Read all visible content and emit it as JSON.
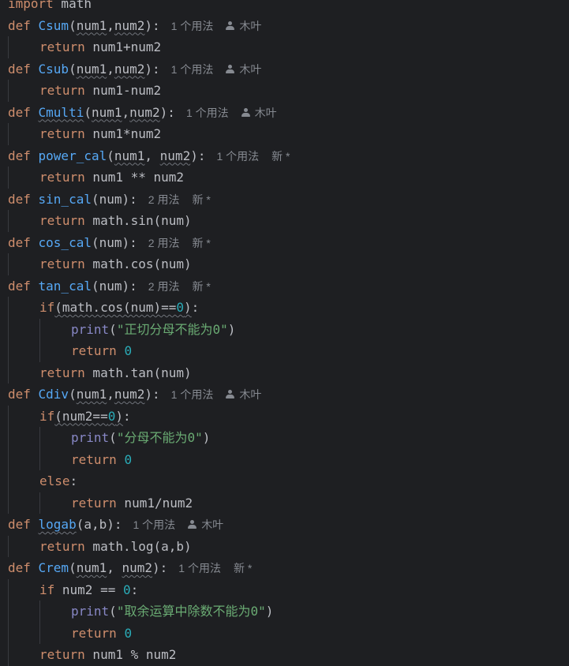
{
  "editor": {
    "lines": [
      {
        "code": "import math",
        "segs": [
          {
            "t": "import",
            "c": "kw"
          },
          {
            "t": " math",
            "c": "id"
          }
        ]
      },
      {
        "code": "def Csum(num1,num2):",
        "segs": [
          {
            "t": "def ",
            "c": "kw"
          },
          {
            "t": "Csum",
            "c": "fn"
          },
          {
            "t": "(",
            "c": "id"
          },
          {
            "t": "num1",
            "c": "id",
            "squiggle": true
          },
          {
            "t": ",",
            "c": "id"
          },
          {
            "t": "num2",
            "c": "id",
            "squiggle": true
          },
          {
            "t": "):",
            "c": "id"
          }
        ],
        "usages": "1 个用法",
        "author": "木叶"
      },
      {
        "code": "    return num1+num2",
        "indent": 1,
        "segs": [
          {
            "t": "return",
            "c": "kw"
          },
          {
            "t": " num1+num2",
            "c": "id"
          }
        ]
      },
      {
        "code": "def Csub(num1,num2):",
        "segs": [
          {
            "t": "def ",
            "c": "kw"
          },
          {
            "t": "Csub",
            "c": "fn"
          },
          {
            "t": "(",
            "c": "id"
          },
          {
            "t": "num1",
            "c": "id",
            "squiggle": true
          },
          {
            "t": ",",
            "c": "id"
          },
          {
            "t": "num2",
            "c": "id",
            "squiggle": true
          },
          {
            "t": "):",
            "c": "id"
          }
        ],
        "usages": "1 个用法",
        "author": "木叶"
      },
      {
        "code": "    return num1-num2",
        "indent": 1,
        "segs": [
          {
            "t": "return",
            "c": "kw"
          },
          {
            "t": " num1-num2",
            "c": "id"
          }
        ]
      },
      {
        "code": "def Cmulti(num1,num2):",
        "segs": [
          {
            "t": "def ",
            "c": "kw"
          },
          {
            "t": "Cmulti",
            "c": "fn",
            "squiggle": true
          },
          {
            "t": "(",
            "c": "id"
          },
          {
            "t": "num1",
            "c": "id",
            "squiggle": true
          },
          {
            "t": ",",
            "c": "id"
          },
          {
            "t": "num2",
            "c": "id",
            "squiggle": true
          },
          {
            "t": "):",
            "c": "id"
          }
        ],
        "usages": "1 个用法",
        "author": "木叶"
      },
      {
        "code": "    return num1*num2",
        "indent": 1,
        "segs": [
          {
            "t": "return",
            "c": "kw"
          },
          {
            "t": " num1*num2",
            "c": "id"
          }
        ]
      },
      {
        "code": "def power_cal(num1, num2):",
        "segs": [
          {
            "t": "def ",
            "c": "kw"
          },
          {
            "t": "power_cal",
            "c": "fn"
          },
          {
            "t": "(",
            "c": "id"
          },
          {
            "t": "num1",
            "c": "id",
            "squiggle": true
          },
          {
            "t": ", ",
            "c": "id"
          },
          {
            "t": "num2",
            "c": "id",
            "squiggle": true
          },
          {
            "t": "):",
            "c": "id"
          }
        ],
        "usages": "1 个用法",
        "status": "新 *"
      },
      {
        "code": "    return num1 ** num2",
        "indent": 1,
        "segs": [
          {
            "t": "return",
            "c": "kw"
          },
          {
            "t": " num1 ** num2",
            "c": "id"
          }
        ]
      },
      {
        "code": "def sin_cal(num):",
        "segs": [
          {
            "t": "def ",
            "c": "kw"
          },
          {
            "t": "sin_cal",
            "c": "fn"
          },
          {
            "t": "(num):",
            "c": "id"
          }
        ],
        "usages": "2 用法",
        "status": "新 *"
      },
      {
        "code": "    return math.sin(num)",
        "indent": 1,
        "segs": [
          {
            "t": "return",
            "c": "kw"
          },
          {
            "t": " math.sin(num)",
            "c": "id"
          }
        ]
      },
      {
        "code": "def cos_cal(num):",
        "segs": [
          {
            "t": "def ",
            "c": "kw"
          },
          {
            "t": "cos_cal",
            "c": "fn"
          },
          {
            "t": "(num):",
            "c": "id"
          }
        ],
        "usages": "2 用法",
        "status": "新 *"
      },
      {
        "code": "    return math.cos(num)",
        "indent": 1,
        "segs": [
          {
            "t": "return",
            "c": "kw"
          },
          {
            "t": " math.cos(num)",
            "c": "id"
          }
        ]
      },
      {
        "code": "def tan_cal(num):",
        "segs": [
          {
            "t": "def ",
            "c": "kw"
          },
          {
            "t": "tan_cal",
            "c": "fn"
          },
          {
            "t": "(num):",
            "c": "id"
          }
        ],
        "usages": "2 用法",
        "status": "新 *"
      },
      {
        "code": "    if(math.cos(num)==0):",
        "indent": 1,
        "segs": [
          {
            "t": "if",
            "c": "kw"
          },
          {
            "t": "(math.cos(num)==",
            "c": "id",
            "squiggle": true
          },
          {
            "t": "0",
            "c": "num",
            "squiggle": true
          },
          {
            "t": ")",
            "c": "id",
            "squiggle": true
          },
          {
            "t": ":",
            "c": "id"
          }
        ]
      },
      {
        "code": "        print(\"正切分母不能为0\")",
        "indent": 2,
        "segs": [
          {
            "t": "print",
            "c": "builtin"
          },
          {
            "t": "(",
            "c": "id"
          },
          {
            "t": "\"正切分母不能为0\"",
            "c": "str"
          },
          {
            "t": ")",
            "c": "id"
          }
        ]
      },
      {
        "code": "        return 0",
        "indent": 2,
        "segs": [
          {
            "t": "return",
            "c": "kw"
          },
          {
            "t": " ",
            "c": "id"
          },
          {
            "t": "0",
            "c": "num"
          }
        ]
      },
      {
        "code": "    return math.tan(num)",
        "indent": 1,
        "segs": [
          {
            "t": "return",
            "c": "kw"
          },
          {
            "t": " math.tan(num)",
            "c": "id"
          }
        ]
      },
      {
        "code": "def Cdiv(num1,num2):",
        "segs": [
          {
            "t": "def ",
            "c": "kw"
          },
          {
            "t": "Cdiv",
            "c": "fn"
          },
          {
            "t": "(",
            "c": "id"
          },
          {
            "t": "num1",
            "c": "id",
            "squiggle": true
          },
          {
            "t": ",",
            "c": "id"
          },
          {
            "t": "num2",
            "c": "id",
            "squiggle": true
          },
          {
            "t": "):",
            "c": "id"
          }
        ],
        "usages": "1 个用法",
        "author": "木叶"
      },
      {
        "code": "    if(num2==0):",
        "indent": 1,
        "segs": [
          {
            "t": "if",
            "c": "kw"
          },
          {
            "t": "(num2==",
            "c": "id",
            "squiggle": true
          },
          {
            "t": "0",
            "c": "num",
            "squiggle": true
          },
          {
            "t": ")",
            "c": "id",
            "squiggle": true
          },
          {
            "t": ":",
            "c": "id"
          }
        ]
      },
      {
        "code": "        print(\"分母不能为0\")",
        "indent": 2,
        "segs": [
          {
            "t": "print",
            "c": "builtin"
          },
          {
            "t": "(",
            "c": "id"
          },
          {
            "t": "\"分母不能为0\"",
            "c": "str"
          },
          {
            "t": ")",
            "c": "id"
          }
        ]
      },
      {
        "code": "        return 0",
        "indent": 2,
        "segs": [
          {
            "t": "return",
            "c": "kw"
          },
          {
            "t": " ",
            "c": "id"
          },
          {
            "t": "0",
            "c": "num"
          }
        ]
      },
      {
        "code": "    else:",
        "indent": 1,
        "segs": [
          {
            "t": "else",
            "c": "kw"
          },
          {
            "t": ":",
            "c": "id"
          }
        ]
      },
      {
        "code": "        return num1/num2",
        "indent": 2,
        "segs": [
          {
            "t": "return",
            "c": "kw"
          },
          {
            "t": " num1/num2",
            "c": "id"
          }
        ]
      },
      {
        "code": "def logab(a,b):",
        "segs": [
          {
            "t": "def ",
            "c": "kw"
          },
          {
            "t": "logab",
            "c": "fn",
            "squiggle": true
          },
          {
            "t": "(a,b):",
            "c": "id"
          }
        ],
        "usages": "1 个用法",
        "author": "木叶"
      },
      {
        "code": "    return math.log(a,b)",
        "indent": 1,
        "segs": [
          {
            "t": "return",
            "c": "kw"
          },
          {
            "t": " math.log(a,b)",
            "c": "id"
          }
        ]
      },
      {
        "code": "def Crem(num1, num2):",
        "segs": [
          {
            "t": "def ",
            "c": "kw"
          },
          {
            "t": "Crem",
            "c": "fn"
          },
          {
            "t": "(",
            "c": "id"
          },
          {
            "t": "num1",
            "c": "id",
            "squiggle": true
          },
          {
            "t": ", ",
            "c": "id"
          },
          {
            "t": "num2",
            "c": "id",
            "squiggle": true
          },
          {
            "t": "):",
            "c": "id"
          }
        ],
        "usages": "1 个用法",
        "status": "新 *"
      },
      {
        "code": "    if num2 == 0:",
        "indent": 1,
        "segs": [
          {
            "t": "if",
            "c": "kw"
          },
          {
            "t": " num2 == ",
            "c": "id"
          },
          {
            "t": "0",
            "c": "num"
          },
          {
            "t": ":",
            "c": "id"
          }
        ]
      },
      {
        "code": "        print(\"取余运算中除数不能为0\")",
        "indent": 2,
        "segs": [
          {
            "t": "print",
            "c": "builtin"
          },
          {
            "t": "(",
            "c": "id"
          },
          {
            "t": "\"取余运算中除数不能为0\"",
            "c": "str"
          },
          {
            "t": ")",
            "c": "id"
          }
        ]
      },
      {
        "code": "        return 0",
        "indent": 2,
        "segs": [
          {
            "t": "return",
            "c": "kw"
          },
          {
            "t": " ",
            "c": "id"
          },
          {
            "t": "0",
            "c": "num"
          }
        ]
      },
      {
        "code": "    return num1 % num2",
        "indent": 1,
        "segs": [
          {
            "t": "return",
            "c": "kw"
          },
          {
            "t": " num1 % num2",
            "c": "id"
          }
        ]
      }
    ]
  },
  "colors": {
    "background": "#1e1f22",
    "keyword": "#cf8e6d",
    "function": "#56a8f5",
    "builtin": "#8888c6",
    "number": "#2aacb8",
    "string": "#6aab73",
    "text": "#bcbec4",
    "hint": "#868a91"
  },
  "icons": {
    "author": "user-icon"
  }
}
